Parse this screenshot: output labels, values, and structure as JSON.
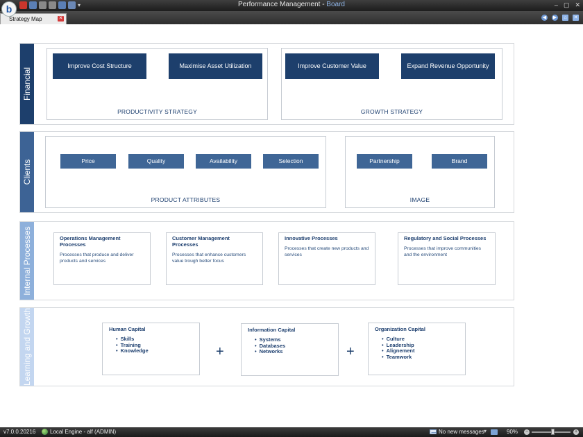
{
  "window": {
    "title_main": "Performance Management - ",
    "title_accent": "Board",
    "logo_letter": "b",
    "controls": [
      "–",
      "▢",
      "✕"
    ]
  },
  "tabs": [
    {
      "label": "Strategy Map",
      "close": "✕"
    }
  ],
  "nav_icons": [
    "◀",
    "▶",
    "⌂",
    "✕"
  ],
  "strategy_map": {
    "financial": {
      "label": "Financial",
      "color": "#1d3f6c",
      "groups": [
        {
          "caption": "PRODUCTIVITY STRATEGY",
          "objectives": [
            "Improve Cost Structure",
            "Maximise Asset Utilization"
          ]
        },
        {
          "caption": "GROWTH STRATEGY",
          "objectives": [
            "Improve Customer Value",
            "Expand Revenue Opportunity"
          ]
        }
      ]
    },
    "clients": {
      "label": "Clients",
      "color": "#3d6395",
      "groups": [
        {
          "caption": "PRODUCT ATTRIBUTES",
          "objectives": [
            "Price",
            "Quality",
            "Availability",
            "Selection"
          ]
        },
        {
          "caption": "IMAGE",
          "objectives": [
            "Partnership",
            "Brand"
          ]
        }
      ]
    },
    "internal": {
      "label": "Internal Processes",
      "color": "#8eb0db",
      "processes": [
        {
          "title": "Operations Management Processes",
          "desc": "Processes that produce and deliver products and services"
        },
        {
          "title": "Customer Management Processes",
          "desc": "Processes that enhance customers value trough better focus"
        },
        {
          "title": "Innovative Processes",
          "desc": "Processes that create new products and services"
        },
        {
          "title": "Regulatory and Social Processes",
          "desc": "Processes that improve communities and the environment"
        }
      ]
    },
    "learning": {
      "label": "Learning and Growth",
      "color": "#c3d6f0",
      "plus": "+",
      "capitals": [
        {
          "title": "Human Capital",
          "items": [
            "Skills",
            "Training",
            "Knowledge"
          ]
        },
        {
          "title": "Information Capital",
          "items": [
            "Systems",
            "Databases",
            "Networks"
          ]
        },
        {
          "title": "Organization Capital",
          "items": [
            "Culture",
            "Leadership",
            "Alignement",
            "Teamwork"
          ]
        }
      ]
    }
  },
  "status": {
    "version": "v7.0.0.20216",
    "engine": "Local Engine - alf (ADMIN)",
    "messages": "No new messages",
    "chevron": "▾",
    "zoom": "90%",
    "zoom_level": 0.55
  }
}
